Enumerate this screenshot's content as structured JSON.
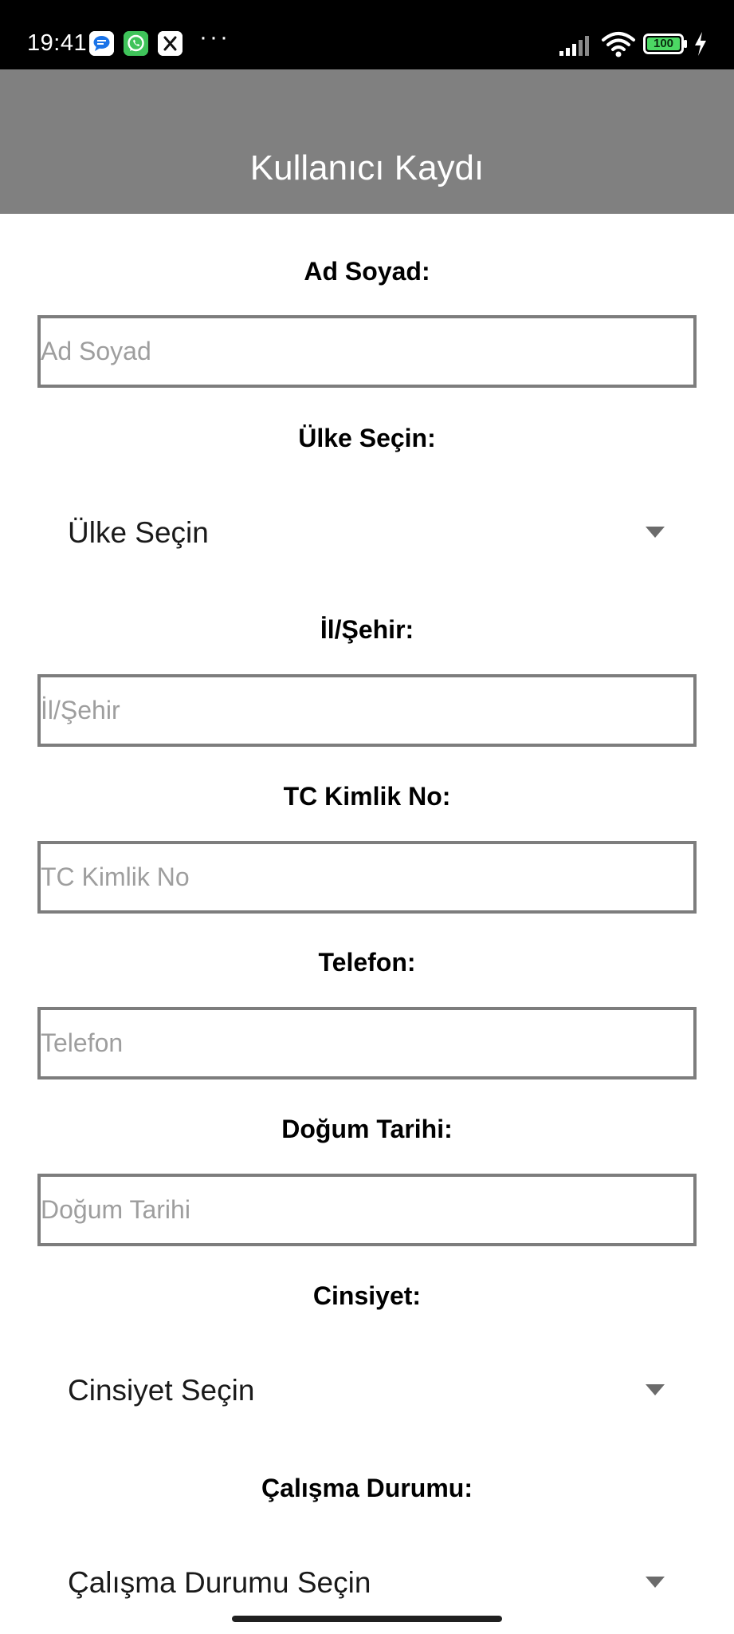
{
  "status_bar": {
    "time": "19:41",
    "notification_icons": [
      "messages-icon",
      "whatsapp-icon",
      "x-icon"
    ],
    "more": "···",
    "battery_level": "100"
  },
  "app_bar": {
    "title": "Kullanıcı Kaydı"
  },
  "form": {
    "name": {
      "label": "Ad Soyad:",
      "placeholder": "Ad Soyad",
      "value": ""
    },
    "country": {
      "label": "Ülke Seçin:",
      "selected": "Ülke Seçin"
    },
    "city": {
      "label": "İl/Şehir:",
      "placeholder": "İl/Şehir",
      "value": ""
    },
    "tc": {
      "label": "TC Kimlik No:",
      "placeholder": "TC Kimlik No",
      "value": ""
    },
    "phone": {
      "label": "Telefon:",
      "placeholder": "Telefon",
      "value": ""
    },
    "birth_date": {
      "label": "Doğum Tarihi:",
      "placeholder": "Doğum Tarihi",
      "value": ""
    },
    "gender": {
      "label": "Cinsiyet:",
      "selected": "Cinsiyet Seçin"
    },
    "work_status": {
      "label": "Çalışma Durumu:",
      "selected": "Çalışma Durumu Seçin"
    }
  },
  "colors": {
    "app_bar": "#808080",
    "input_border": "#7d7d7d",
    "placeholder": "#9e9e9e",
    "status_bar": "#000000"
  }
}
